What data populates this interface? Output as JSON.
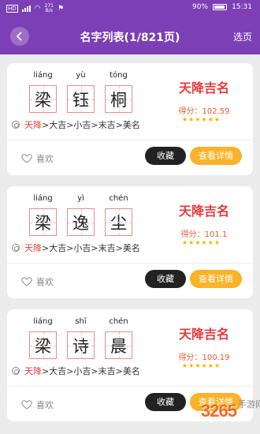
{
  "status": {
    "signal": "HD",
    "speed_value": "271",
    "speed_unit": "B/s",
    "battery": "90%",
    "time": "15:31"
  },
  "header": {
    "title": "名字列表(1/821页)",
    "select_page": "选页"
  },
  "cards": [
    {
      "chars": [
        {
          "pinyin": "liáng",
          "char": "梁"
        },
        {
          "pinyin": "yù",
          "char": "钰"
        },
        {
          "pinyin": "tóng",
          "char": "桐"
        }
      ],
      "badge": "天降吉名",
      "score_label": "得分：",
      "score_value": "102.59",
      "stars": 6,
      "luck_highlight": "天降",
      "luck_rest": ">大吉>小吉>末吉>美名",
      "like_label": "喜欢",
      "fav_label": "收藏",
      "detail_label": "查看详情"
    },
    {
      "chars": [
        {
          "pinyin": "liáng",
          "char": "梁"
        },
        {
          "pinyin": "yì",
          "char": "逸"
        },
        {
          "pinyin": "chén",
          "char": "尘"
        }
      ],
      "badge": "天降吉名",
      "score_label": "得分：",
      "score_value": "101.1",
      "stars": 6,
      "luck_highlight": "天降",
      "luck_rest": ">大吉>小吉>末吉>美名",
      "like_label": "喜欢",
      "fav_label": "收藏",
      "detail_label": "查看详情"
    },
    {
      "chars": [
        {
          "pinyin": "liáng",
          "char": "梁"
        },
        {
          "pinyin": "shī",
          "char": "诗"
        },
        {
          "pinyin": "chén",
          "char": "晨"
        }
      ],
      "badge": "天降吉名",
      "score_label": "得分：",
      "score_value": "100.19",
      "stars": 6,
      "luck_highlight": "天降",
      "luck_rest": ">大吉>小吉>末吉>美名",
      "like_label": "喜欢",
      "fav_label": "收藏",
      "detail_label": "查看详情"
    }
  ],
  "watermark": {
    "number": "3265",
    "text": "手游网"
  },
  "colors": {
    "header": "#7c3fb6",
    "badge": "#e63b3b",
    "star": "#f5b400",
    "detail_button": "#f9b32a",
    "fav_button": "#222222"
  }
}
